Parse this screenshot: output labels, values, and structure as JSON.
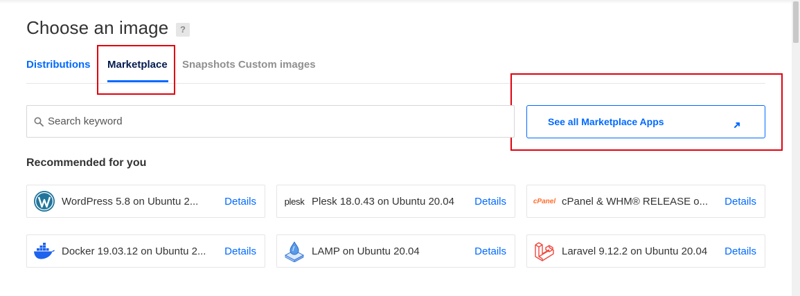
{
  "page": {
    "title": "Choose an image",
    "help_label": "?"
  },
  "tabs": [
    {
      "label": "Distributions"
    },
    {
      "label": "Marketplace"
    },
    {
      "label": "Snapshots Custom images"
    }
  ],
  "search": {
    "placeholder": "Search keyword",
    "value": ""
  },
  "marketplace_button": {
    "label": "See all Marketplace Apps"
  },
  "recommended": {
    "heading": "Recommended for you",
    "details_label": "Details",
    "apps": [
      {
        "name": "WordPress 5.8 on Ubuntu 2...",
        "icon": "wordpress-icon"
      },
      {
        "name": "Plesk 18.0.43 on Ubuntu 20.04",
        "icon": "plesk-icon",
        "logo_text": "plesk"
      },
      {
        "name": "cPanel & WHM® RELEASE o...",
        "icon": "cpanel-icon",
        "logo_text": "cPanel"
      },
      {
        "name": "Docker 19.03.12 on Ubuntu 2...",
        "icon": "docker-icon"
      },
      {
        "name": "LAMP on Ubuntu 20.04",
        "icon": "lamp-icon"
      },
      {
        "name": "Laravel 9.12.2 on Ubuntu 20.04",
        "icon": "laravel-icon"
      }
    ]
  },
  "colors": {
    "accent": "#0069ff",
    "navy": "#031b4e",
    "highlight": "#e0000c"
  }
}
